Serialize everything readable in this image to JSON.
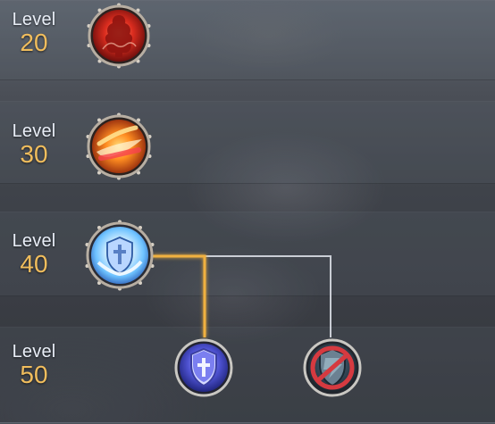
{
  "levels": [
    {
      "word": "Level",
      "number": "20",
      "icon": "rage-fist-icon"
    },
    {
      "word": "Level",
      "number": "30",
      "icon": "flame-slash-icon"
    },
    {
      "word": "Level",
      "number": "40",
      "icon": "holy-shield-icon"
    },
    {
      "word": "Level",
      "number": "50",
      "icon": "cross-shield-icon"
    }
  ],
  "branch_options": [
    {
      "name": "cross-shield-icon",
      "state": "available"
    },
    {
      "name": "no-shield-icon",
      "state": "disabled"
    }
  ],
  "colors": {
    "level_text": "#e9eef7",
    "level_number": "#f0bd5d",
    "active_path": "#f0b13f",
    "inactive_path": "#d9dde4"
  }
}
